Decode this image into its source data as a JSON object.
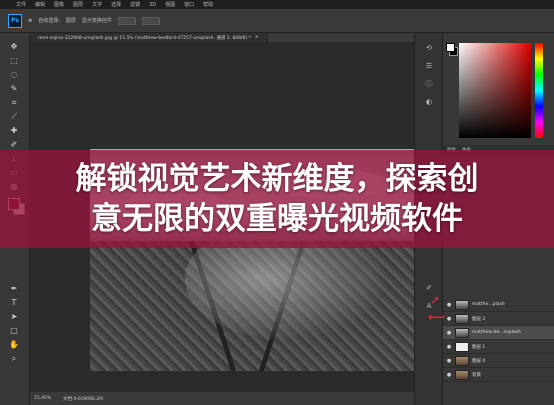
{
  "menubar": {
    "items": [
      "文件",
      "编辑",
      "图像",
      "图层",
      "文字",
      "选择",
      "滤镜",
      "3D",
      "视图",
      "窗口",
      "帮助"
    ]
  },
  "options": {
    "logo": "Ps",
    "select_label": "自动选择:",
    "select_value": "图层",
    "transform_label": "显示变换控件"
  },
  "document": {
    "tab1": "rene-zajina-322968-unsplash.jpg @ 15.5% (matthew-bedford-47257-unsplash, 通道 2, 808/8) *",
    "tab2": "×"
  },
  "status": {
    "zoom": "15.46%",
    "doc_size": "文档:9.60M/86.2M"
  },
  "layers": [
    {
      "visible": "●",
      "name": "matthe...plash",
      "thumb": "bw"
    },
    {
      "visible": "●",
      "name": "图层 2",
      "thumb": "bw"
    },
    {
      "visible": "●",
      "name": "matthew-be...nsplash",
      "thumb": "bw",
      "active": true
    },
    {
      "visible": "●",
      "name": "图层 1",
      "thumb": "white"
    },
    {
      "visible": "●",
      "name": "图层 0",
      "thumb": "warm"
    },
    {
      "visible": "●",
      "name": "背景",
      "thumb": "warm"
    }
  ],
  "panel_tabs": [
    "颜色",
    "色板"
  ],
  "banner": {
    "line1": "解锁视觉艺术新维度，探索创",
    "line2": "意无限的双重曝光视频软件"
  },
  "colors": {
    "banner": "#96143c",
    "accent": "#31a8ff",
    "arrow": "#e02a3a"
  }
}
